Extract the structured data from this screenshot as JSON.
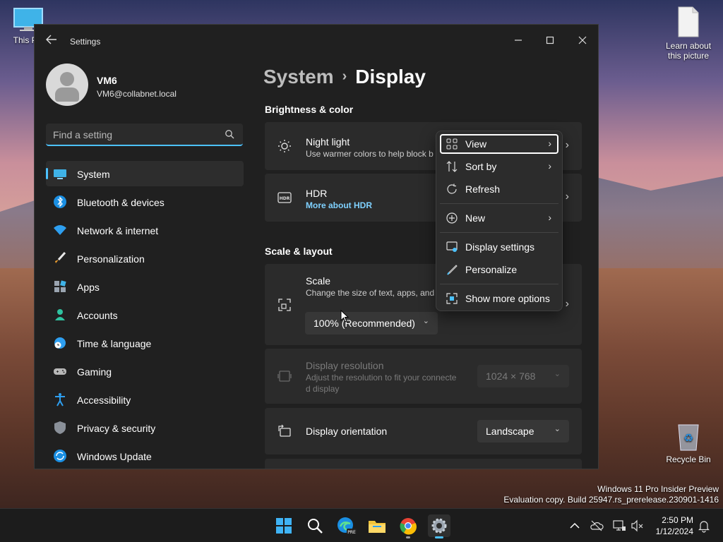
{
  "desktop": {
    "icons": [
      {
        "label": "This PC"
      },
      {
        "label": "Learn about this picture"
      },
      {
        "label": "Recycle Bin"
      }
    ],
    "watermark": {
      "line1": "Windows 11 Pro Insider Preview",
      "line2": "Evaluation copy. Build 25947.rs_prerelease.230901-1416"
    }
  },
  "window": {
    "title": "Settings",
    "profile": {
      "name": "VM6",
      "email": "VM6@collabnet.local"
    },
    "search": {
      "placeholder": "Find a setting"
    },
    "nav": [
      {
        "label": "System",
        "icon": "monitor-icon",
        "active": true
      },
      {
        "label": "Bluetooth & devices",
        "icon": "bluetooth-icon"
      },
      {
        "label": "Network & internet",
        "icon": "wifi-icon"
      },
      {
        "label": "Personalization",
        "icon": "brush-icon"
      },
      {
        "label": "Apps",
        "icon": "apps-icon"
      },
      {
        "label": "Accounts",
        "icon": "person-icon"
      },
      {
        "label": "Time & language",
        "icon": "globe-clock-icon"
      },
      {
        "label": "Gaming",
        "icon": "gamepad-icon"
      },
      {
        "label": "Accessibility",
        "icon": "accessibility-icon"
      },
      {
        "label": "Privacy & security",
        "icon": "shield-icon"
      },
      {
        "label": "Windows Update",
        "icon": "update-icon"
      }
    ],
    "breadcrumb": {
      "parent": "System",
      "current": "Display"
    },
    "sections": {
      "brightness": "Brightness & color",
      "scale_layout": "Scale & layout"
    },
    "cards": {
      "night_light": {
        "title": "Night light",
        "subtitle": "Use warmer colors to help block b"
      },
      "hdr": {
        "title": "HDR",
        "link": "More about HDR"
      },
      "scale": {
        "title": "Scale",
        "subtitle": "Change the size of text, apps, and",
        "value": "100% (Recommended)"
      },
      "resolution": {
        "title": "Display resolution",
        "subtitle1": "Adjust the resolution to fit your connecte",
        "subtitle2": "d display",
        "value": "1024 × 768"
      },
      "orientation": {
        "title": "Display orientation",
        "value": "Landscape"
      }
    }
  },
  "context_menu": {
    "items": [
      {
        "label": "View",
        "icon": "grid-view-icon",
        "submenu": true
      },
      {
        "label": "Sort by",
        "icon": "sort-icon",
        "submenu": true
      },
      {
        "label": "Refresh",
        "icon": "refresh-icon"
      },
      {
        "label": "New",
        "icon": "plus-circle-icon",
        "submenu": true
      },
      {
        "label": "Display settings",
        "icon": "display-settings-icon"
      },
      {
        "label": "Personalize",
        "icon": "pen-icon"
      },
      {
        "label": "Show more options",
        "icon": "more-options-icon"
      }
    ]
  },
  "taskbar": {
    "time": "2:50 PM",
    "date": "1/12/2024"
  },
  "colors": {
    "accent": "#4cc2ff",
    "window_bg": "#202020",
    "card_bg": "#2b2b2b"
  }
}
